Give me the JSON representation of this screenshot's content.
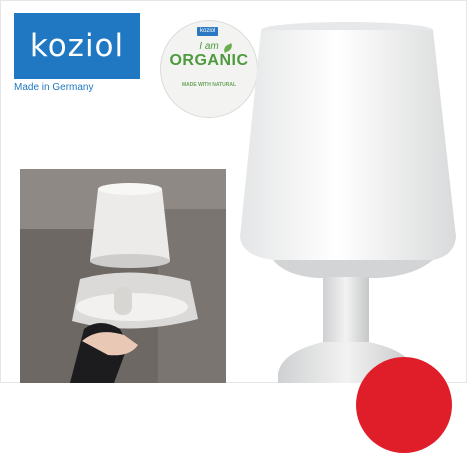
{
  "brand": {
    "logo_text": "koziol",
    "tagline": "Made in Germany"
  },
  "badge": {
    "tag": "koziol",
    "line1": "I am",
    "line2": "ORGANIC",
    "line3": "MADE WITH NATURAL"
  },
  "colors": {
    "brand_blue": "#1f78c1",
    "organic_green": "#4f9a3e",
    "accent_red": "#e01e2a"
  }
}
